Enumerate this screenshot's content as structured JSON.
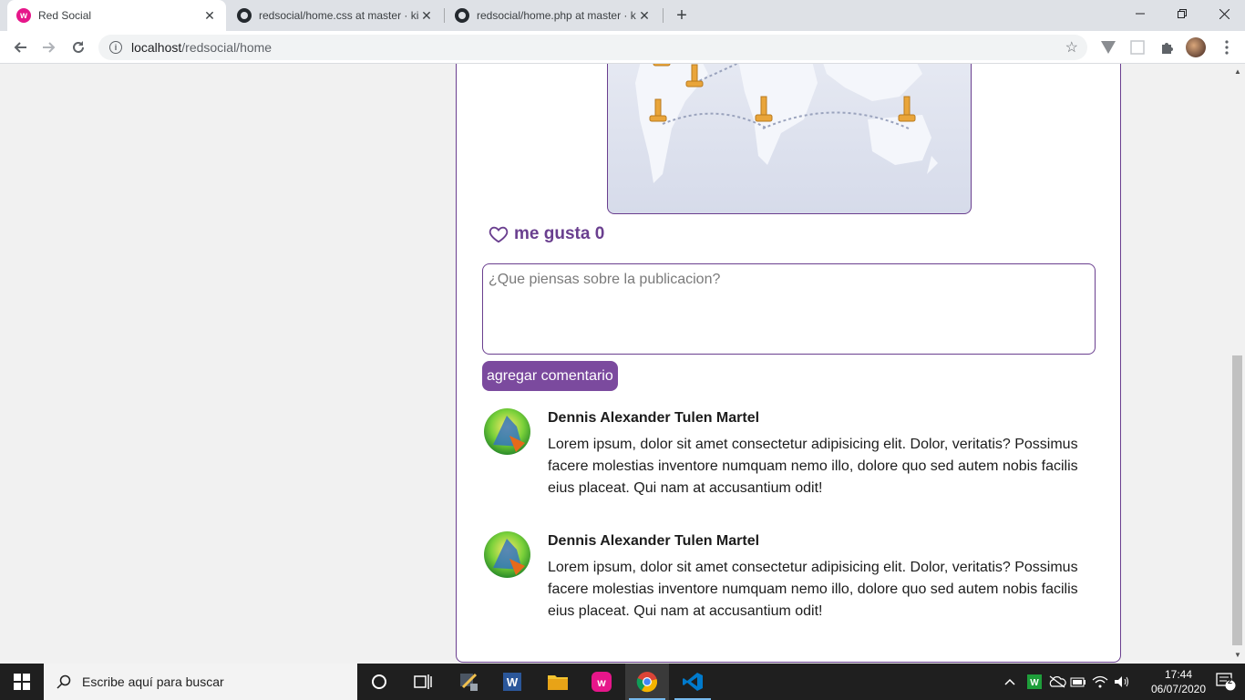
{
  "browser": {
    "tabs": [
      {
        "title": "Red Social",
        "active": true
      },
      {
        "title": "redsocial/home.css at master · kis",
        "active": false
      },
      {
        "title": "redsocial/home.php at master · k",
        "active": false
      }
    ],
    "new_tab_label": "+",
    "url_host": "localhost",
    "url_path": "/redsocial/home"
  },
  "post": {
    "like_label": "me gusta 0",
    "comment_placeholder": "¿Que piensas sobre la publicacion?",
    "add_comment_label": "agregar comentario"
  },
  "comments": [
    {
      "author": "Dennis Alexander Tulen Martel",
      "text": "Lorem ipsum, dolor sit amet consectetur adipisicing elit. Dolor, veritatis? Possimus facere molestias inventore numquam nemo illo, dolore quo sed autem nobis facilis eius placeat. Qui nam at accusantium odit!"
    },
    {
      "author": "Dennis Alexander Tulen Martel",
      "text": "Lorem ipsum, dolor sit amet consectetur adipisicing elit. Dolor, veritatis? Possimus facere molestias inventore numquam nemo illo, dolore quo sed autem nobis facilis eius placeat. Qui nam at accusantium odit!"
    }
  ],
  "taskbar": {
    "search_placeholder": "Escribe aquí para buscar",
    "time": "17:44",
    "date": "06/07/2020",
    "notification_count": "2"
  },
  "colors": {
    "accent": "#6a3f8f",
    "button": "#7b4a9e"
  }
}
